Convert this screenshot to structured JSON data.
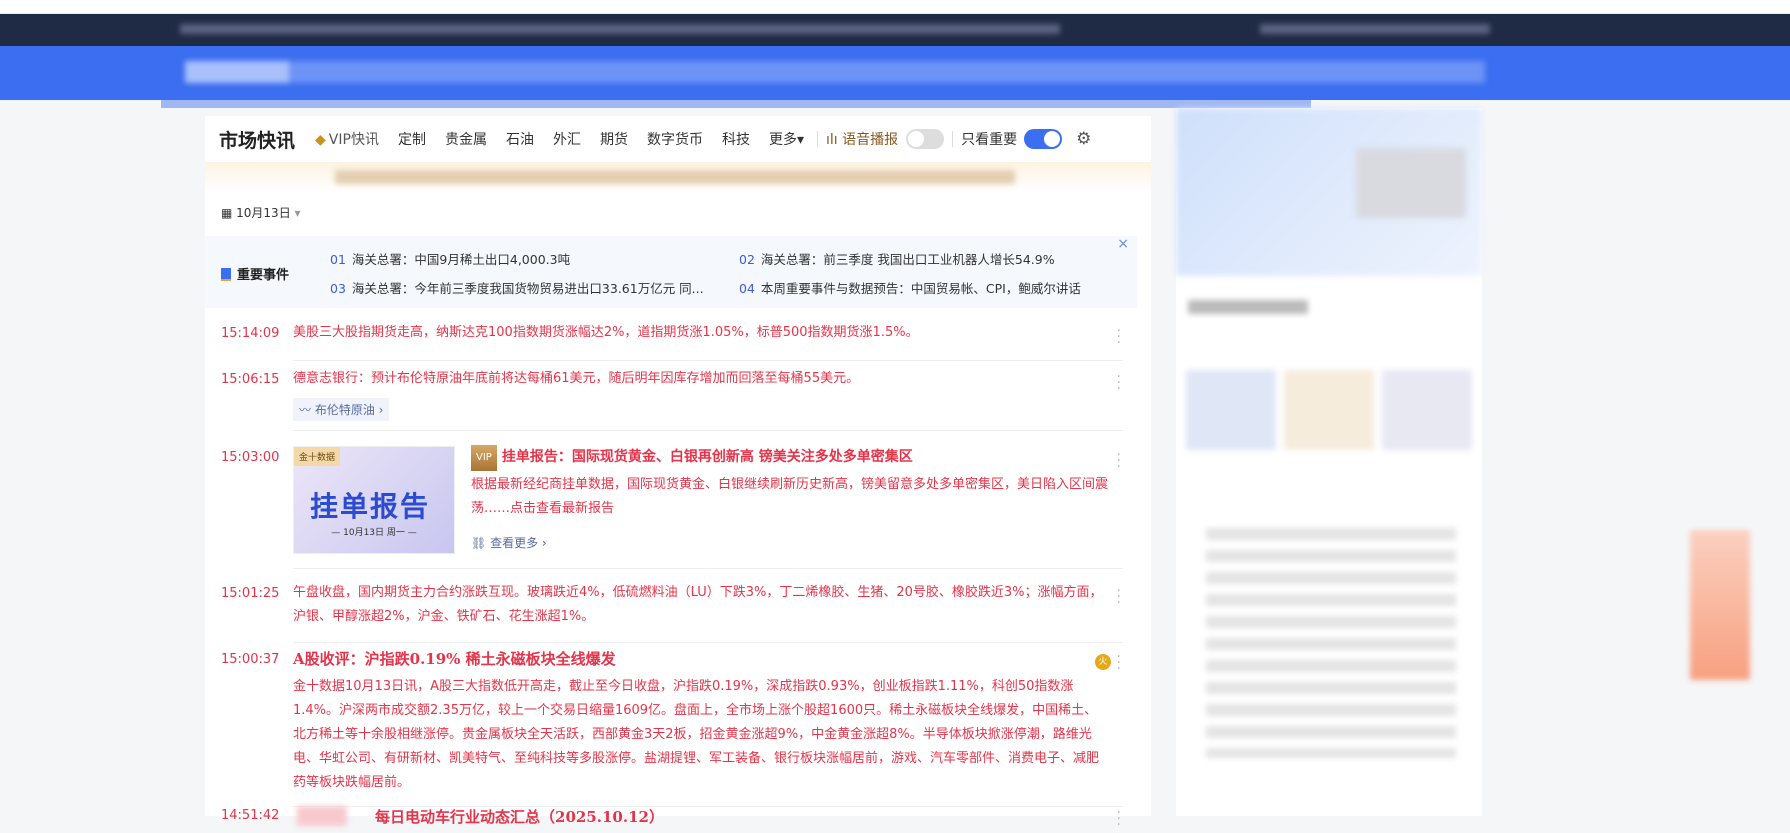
{
  "nav": {
    "title": "市场快讯",
    "tabs": [
      "VIP快讯",
      "定制",
      "贵金属",
      "石油",
      "外汇",
      "期货",
      "数字货币",
      "科技",
      "更多▾"
    ],
    "voice_label": "语音播报",
    "voice_on": false,
    "important_only_label": "只看重要",
    "important_only_on": true
  },
  "date": "10月13日",
  "events": {
    "label": "重要事件",
    "items": [
      {
        "num": "01",
        "text": "海关总署：中国9月稀土出口4,000.3吨"
      },
      {
        "num": "02",
        "text": "海关总署：前三季度 我国出口工业机器人增长54.9%"
      },
      {
        "num": "03",
        "text": "海关总署：今年前三季度我国货物贸易进出口33.61万亿元 同..."
      },
      {
        "num": "04",
        "text": "本周重要事件与数据预告：中国贸易帐、CPI，鲍威尔讲话"
      }
    ],
    "close": "×"
  },
  "news": [
    {
      "time": "15:14:09",
      "text": "美股三大股指期货走高，纳斯达克100指数期货涨幅达2%，道指期货涨1.05%，标普500指数期货涨1.5%。"
    },
    {
      "time": "15:06:15",
      "text": "德意志银行：预计布伦特原油年底前将达每桶61美元，随后明年因库存增加而回落至每桶55美元。",
      "tag": "布伦特原油 ›"
    },
    {
      "time": "15:03:00",
      "badge": "VIP",
      "title": "挂单报告：国际现货黄金、白银再创新高 镑美关注多处多单密集区",
      "text": "根据最新经纪商挂单数据，国际现货黄金、白银继续刷新历史新高，镑美留意多处多单密集区，美日陷入区间震荡……点击查看最新报告",
      "see_more": "查看更多 ›",
      "card_logo": "金十数据",
      "card_title": "挂单报告",
      "card_date": "— 10月13日 周一 —"
    },
    {
      "time": "15:01:25",
      "text": "午盘收盘，国内期货主力合约涨跌互现。玻璃跌近4%，低硫燃料油（LU）下跌3%，丁二烯橡胶、生猪、20号胶、橡胶跌近3%；涨幅方面，沪银、甲醇涨超2%，沪金、铁矿石、花生涨超1%。"
    },
    {
      "time": "15:00:37",
      "title": "A股收评：沪指跌0.19% 稀土永磁板块全线爆发",
      "hot": "火",
      "text": "金十数据10月13日讯，A股三大指数低开高走，截止至今日收盘，沪指跌0.19%，深成指跌0.93%，创业板指跌1.11%，科创50指数涨1.4%。沪深两市成交额2.35万亿，较上一个交易日缩量1609亿。盘面上，全市场上涨个股超1600只。稀土永磁板块全线爆发，中国稀土、北方稀土等十余股相继涨停。贵金属板块全天活跃，西部黄金3天2板，招金黄金涨超9%，中金黄金涨超8%。半导体板块掀涨停潮，路维光电、华虹公司、有研新材、凯美特气、至纯科技等多股涨停。盐湖提锂、军工装备、银行板块涨幅居前，游戏、汽车零部件、消费电子、减肥药等板块跌幅居前。"
    },
    {
      "time": "14:51:42",
      "title": "每日电动车行业动态汇总（2025.10.12）"
    }
  ],
  "colors": {
    "accent": "#3b6ef0",
    "news_red": "#e5344a",
    "navy": "#1f2a44"
  }
}
